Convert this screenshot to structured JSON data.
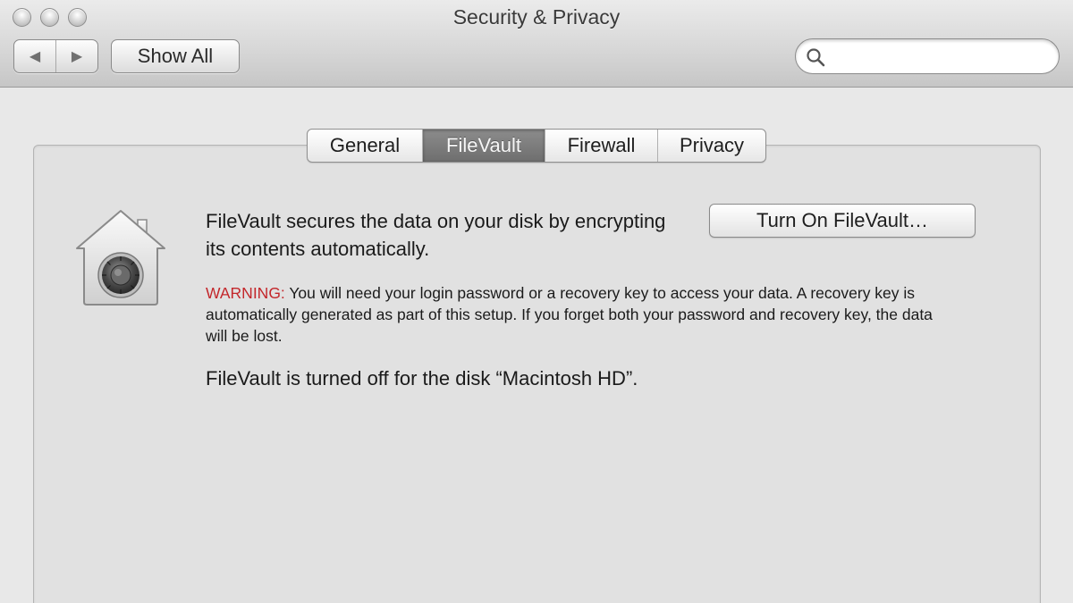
{
  "window": {
    "title": "Security & Privacy"
  },
  "toolbar": {
    "back_icon": "back-arrow-icon",
    "forward_icon": "forward-arrow-icon",
    "back_glyph": "◀",
    "forward_glyph": "▶",
    "show_all_label": "Show All",
    "search": {
      "icon": "search-icon",
      "value": "",
      "placeholder": ""
    }
  },
  "tabs": [
    {
      "label": "General",
      "active": false
    },
    {
      "label": "FileVault",
      "active": true
    },
    {
      "label": "Firewall",
      "active": false
    },
    {
      "label": "Privacy",
      "active": false
    }
  ],
  "filevault": {
    "icon": "filevault-house-vault-icon",
    "description": "FileVault secures the data on your disk by encrypting its contents automatically.",
    "turn_on_button": "Turn On FileVault…",
    "warning_label": "WARNING:",
    "warning_text": " You will need your login password or a recovery key to access your data. A recovery key is automatically generated as part of this setup. If you forget both your password and recovery key, the data will be lost.",
    "status": "FileVault is turned off for the disk “Macintosh HD”."
  },
  "colors": {
    "warning_red": "#c3272b",
    "active_tab": "#7d7d7d",
    "window_background": "#e8e8e8"
  }
}
